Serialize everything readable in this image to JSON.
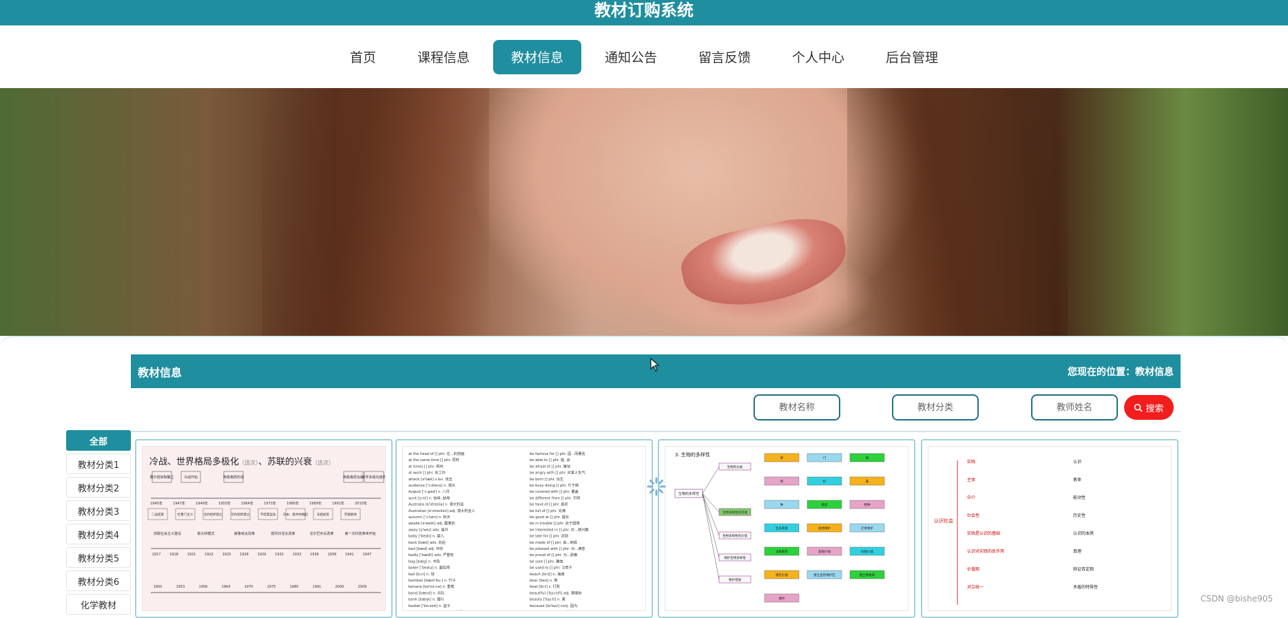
{
  "site": {
    "title": "教材订购系统"
  },
  "nav": {
    "items": [
      "首页",
      "课程信息",
      "教材信息",
      "通知公告",
      "留言反馈",
      "个人中心",
      "后台管理"
    ],
    "active_index": 2
  },
  "banner": {
    "slides_total": 3,
    "active_slide": 1
  },
  "section": {
    "title": "教材信息",
    "breadcrumb": "您现在的位置：教材信息"
  },
  "search": {
    "fields": [
      {
        "placeholder": "教材名称"
      },
      {
        "placeholder": "教材分类"
      },
      {
        "placeholder": "教师姓名"
      }
    ],
    "button_label": "搜索"
  },
  "categories": {
    "items": [
      "全部",
      "教材分类1",
      "教材分类2",
      "教材分类3",
      "教材分类4",
      "教材分类5",
      "教材分类6",
      "化学教材"
    ],
    "active_index": 0
  },
  "cards": {
    "card1": {
      "heading": "冷战、世界格局多极化",
      "heading_small": "（选次）",
      "subheading": "、苏联的兴衰",
      "subheading_small": "（选次）",
      "row1_labels": [
        "雅尔塔体制确立",
        "冷战开始",
        "两极格局形成",
        "两极格局瓦解",
        "世界多极化趋势"
      ],
      "row1_years": [
        "1945年",
        "1947年",
        "1949年",
        "1955年",
        "1964年",
        "1973年",
        "1980年",
        "1989年",
        "1991年",
        "2010年"
      ],
      "row1_marks": [
        "二战结束",
        "杜鲁门主义",
        "北约组织建立",
        "华约组织建立",
        "不结盟运动",
        "日本、欧共体崛起",
        "东欧剧变",
        "苏联解体"
      ],
      "row2_labels": [
        "苏联社会主义建设",
        "斯大林模式",
        "赫鲁晓夫改革",
        "勃列日涅夫改革",
        "戈尔巴乔夫改革",
        "第一次科技革命开始"
      ],
      "row2_years": [
        "1917",
        "1918",
        "1921",
        "1922",
        "1925",
        "1928",
        "1929",
        "1932",
        "1933",
        "1936",
        "1939",
        "1941",
        "1947"
      ],
      "row3_years": [
        "1950",
        "1953",
        "1956",
        "1964",
        "1970",
        "1975",
        "1985",
        "1991",
        "2000",
        "2009"
      ]
    },
    "card2": {
      "lines": [
        "at the head of [] phr. 在...的前面",
        "be famous for [] phr. 因...而著名",
        "at the same time [] phr. 同时",
        "be able to [] phr. 能, 会",
        "at times [] phr. 有时",
        "be afraid of [] phr. 害怕",
        "at work [] phr. 在工作",
        "be angry with [] phr. 对某人生气",
        "attack [ə'tæk] v.&n. 攻击",
        "be born [] phr. 出生",
        "audience ['ɔ:diəns] n. 观众",
        "be busy doing [] phr. 忙于做",
        "August ['ɔ:ɡəst] n. 八月",
        "be covered with [] phr. 覆盖",
        "aunt [ɑ:nt] n. 伯母, 姑母",
        "be different from [] phr. 不同",
        "Australia [ɒ'streɪliə] n. 澳大利亚",
        "be fond of [] phr. 喜欢",
        "Australian [ɒ'streɪliən] adj. 澳大利亚人",
        "be full of [] phr. 充满",
        "autumn ['ɔ:təm] n. 秋天",
        "be good at [] phr. 擅长",
        "awake [ə'weɪk] adj. 醒着的",
        "be in trouble [] phr. 处于困境",
        "away [ə'weɪ] adv. 离开",
        "be interested in [] phr. 对...感兴趣",
        "baby ['beɪbi] n. 婴儿",
        "be late for [] phr. 迟到",
        "back [bæk] adv. 向后",
        "be made of [] phr. 由...制成",
        "bad [bæd] adj. 坏的",
        "be pleased with [] phr. 对...满意",
        "badly ['bædli] adv. 严重地",
        "be proud of [] phr. 为...骄傲",
        "bag [bæɡ] n. 书包",
        "be sure [] phr. 确信",
        "baker ['beɪkə] n. 面包师",
        "be used to [] phr. 习惯于",
        "ball [bɔ:l] n. 球",
        "beach [bi:tʃ] n. 海滩",
        "bamboo [bæm'bu:] n. 竹子",
        "bear [beə] n. 熊",
        "banana [bə'nɑ:nə] n. 香蕉",
        "beat [bi:t] v. 打败",
        "band [bænd] n. 乐队",
        "beautiful ['bju:tɪfl] adj. 美丽的",
        "bank [bæŋk] n. 银行",
        "beauty ['bju:ti] n. 美",
        "basket ['bɑ:skɪt] n. 篮子",
        "because [bɪ'kɒz] conj. 因为",
        "basketball ['bɑ:skɪtbɔ:l] n. 篮球",
        "become [bɪ'kʌm] v. 成为"
      ]
    },
    "card3": {
      "title": "3. 生物的多样性",
      "root": "生物的多样性",
      "branches": [
        "生物的分类",
        "生物多样性的内涵",
        "生物多样性的价值",
        "保护生物多样性",
        "保护措施"
      ],
      "leaves": [
        "界",
        "门",
        "纲",
        "目",
        "科",
        "属",
        "种",
        "基因",
        "物种",
        "生态系统",
        "就地保护",
        "迁地保护",
        "法制教育",
        "直接价值",
        "间接价值",
        "潜在价值",
        "建立自然保护区",
        "建立种质库",
        "保护"
      ]
    },
    "card4": {
      "root": "认识社会",
      "items": [
        "实践",
        "认识",
        "主体",
        "客体",
        "中介",
        "能动性",
        "社会性",
        "历史性",
        "实践是认识的基础",
        "认识的本质",
        "认识对实践的反作用",
        "真理",
        "价值观",
        "辩证否定观",
        "对立统一",
        "矛盾的特殊性"
      ]
    }
  },
  "watermark": "CSDN @bishe905"
}
